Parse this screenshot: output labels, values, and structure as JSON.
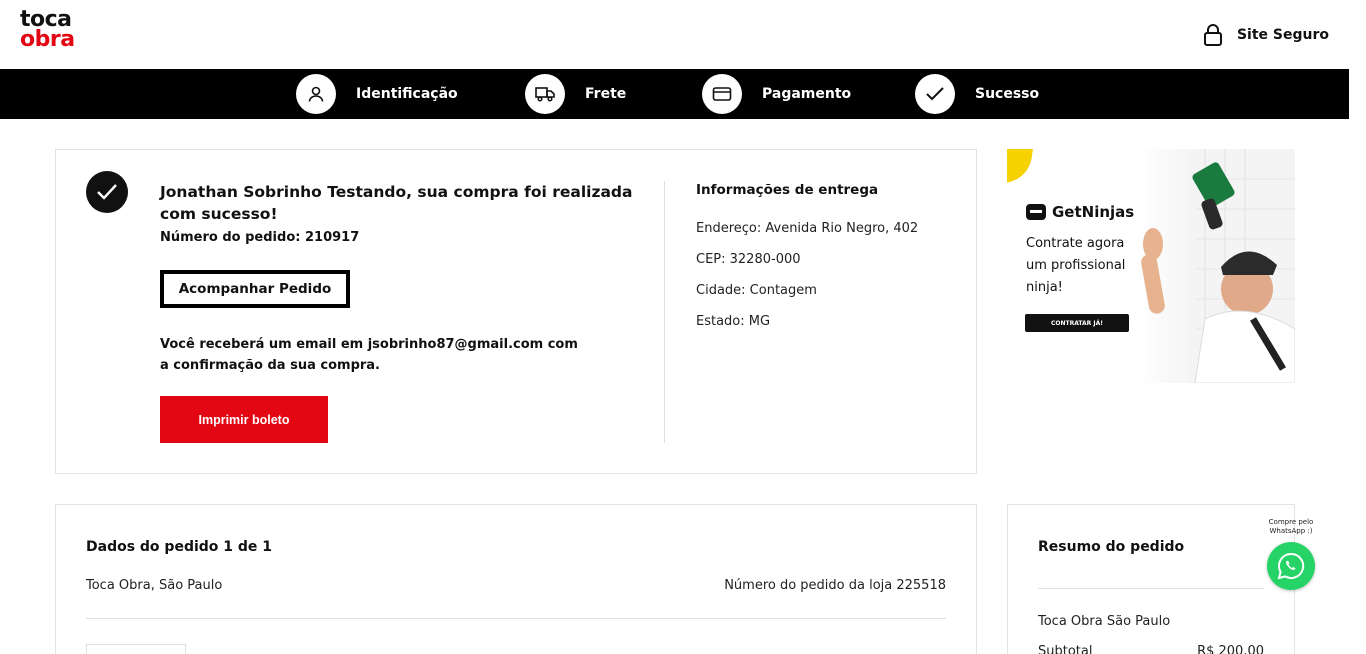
{
  "header": {
    "logo_line1": "toca",
    "logo_line2": "obra",
    "secure_label": "Site Seguro"
  },
  "steps": [
    {
      "label": "Identificação",
      "icon": "user-icon"
    },
    {
      "label": "Frete",
      "icon": "truck-icon"
    },
    {
      "label": "Pagamento",
      "icon": "credit-card-icon"
    },
    {
      "label": "Sucesso",
      "icon": "check-icon"
    }
  ],
  "success": {
    "title": "Jonathan Sobrinho Testando, sua compra foi realizada com sucesso!",
    "order_number": "Número do pedido: 210917",
    "track_button": "Acompanhar Pedido",
    "email_message": "Você receberá um email em jsobrinho87@gmail.com com a confirmação da sua compra.",
    "print_button": "Imprimir boleto"
  },
  "delivery": {
    "title": "Informações de entrega",
    "address": "Endereço: Avenida Rio Negro, 402",
    "cep": "CEP: 32280-000",
    "city": "Cidade: Contagem",
    "state": "Estado: MG"
  },
  "ad": {
    "brand": "GetNinjas",
    "tagline": "Contrate agora um profissional ninja!",
    "cta": "CONTRATAR JÁ!"
  },
  "order_data": {
    "title": "Dados do pedido 1 de 1",
    "store": "Toca Obra, São Paulo",
    "store_order": "Número do pedido da loja 225518"
  },
  "summary": {
    "title": "Resumo do pedido",
    "store": "Toca Obra São Paulo",
    "subtotal_label": "Subtotal",
    "subtotal_value": "R$ 200,00"
  },
  "whatsapp": {
    "text": "Compre pelo WhatsApp :)"
  },
  "colors": {
    "brand_red": "#e30613",
    "black": "#000000",
    "whatsapp_green": "#25d366"
  }
}
